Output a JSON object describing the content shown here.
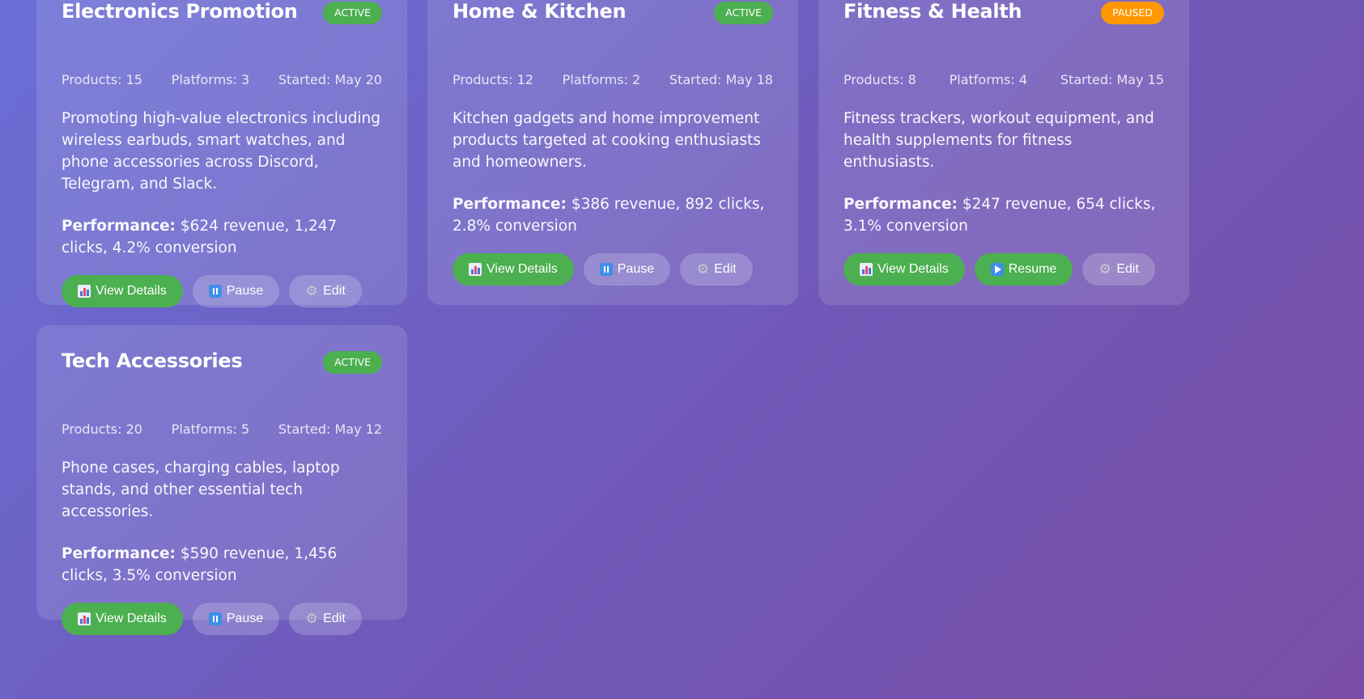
{
  "campaigns": [
    {
      "title": "Electronics Promotion",
      "status": "ACTIVE",
      "products": "Products: 15",
      "platforms": "Platforms: 3",
      "started": "Started: May 20",
      "description": "Promoting high-value electronics including wireless earbuds, smart watches, and phone accessories across Discord, Telegram, and Slack.",
      "performance_label": "Performance:",
      "performance_text": " $624 revenue, 1,247 clicks, 4.2% conversion",
      "buttons": [
        "View Details",
        "Pause",
        "Edit"
      ]
    },
    {
      "title": "Home & Kitchen",
      "status": "ACTIVE",
      "products": "Products: 12",
      "platforms": "Platforms: 2",
      "started": "Started: May 18",
      "description": "Kitchen gadgets and home improvement products targeted at cooking enthusiasts and homeowners.",
      "performance_label": "Performance:",
      "performance_text": " $386 revenue, 892 clicks, 2.8% conversion",
      "buttons": [
        "View Details",
        "Pause",
        "Edit"
      ]
    },
    {
      "title": "Fitness & Health",
      "status": "PAUSED",
      "products": "Products: 8",
      "platforms": "Platforms: 4",
      "started": "Started: May 15",
      "description": "Fitness trackers, workout equipment, and health supplements for fitness enthusiasts.",
      "performance_label": "Performance:",
      "performance_text": " $247 revenue, 654 clicks, 3.1% conversion",
      "buttons": [
        "View Details",
        "Resume",
        "Edit"
      ]
    },
    {
      "title": "Tech Accessories",
      "status": "ACTIVE",
      "products": "Products: 20",
      "platforms": "Platforms: 5",
      "started": "Started: May 12",
      "description": "Phone cases, charging cables, laptop stands, and other essential tech accessories.",
      "performance_label": "Performance:",
      "performance_text": " $590 revenue, 1,456 clicks, 3.5% conversion",
      "buttons": [
        "View Details",
        "Pause",
        "Edit"
      ]
    }
  ],
  "icons": {
    "view_details": "bar-chart-icon",
    "pause": "pause-icon",
    "resume": "play-icon",
    "edit": "gear-icon"
  },
  "colors": {
    "active_badge": "#4caf50",
    "paused_badge": "#ff9800",
    "primary_button": "#4caf50"
  }
}
